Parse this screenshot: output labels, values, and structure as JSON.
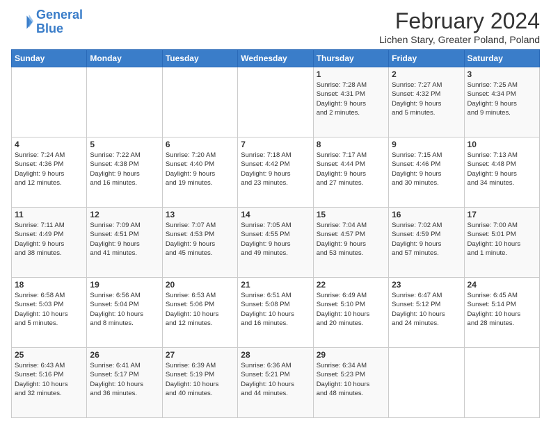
{
  "header": {
    "logo_line1": "General",
    "logo_line2": "Blue",
    "main_title": "February 2024",
    "subtitle": "Lichen Stary, Greater Poland, Poland"
  },
  "calendar": {
    "headers": [
      "Sunday",
      "Monday",
      "Tuesday",
      "Wednesday",
      "Thursday",
      "Friday",
      "Saturday"
    ],
    "weeks": [
      [
        {
          "day": "",
          "info": ""
        },
        {
          "day": "",
          "info": ""
        },
        {
          "day": "",
          "info": ""
        },
        {
          "day": "",
          "info": ""
        },
        {
          "day": "1",
          "info": "Sunrise: 7:28 AM\nSunset: 4:31 PM\nDaylight: 9 hours\nand 2 minutes."
        },
        {
          "day": "2",
          "info": "Sunrise: 7:27 AM\nSunset: 4:32 PM\nDaylight: 9 hours\nand 5 minutes."
        },
        {
          "day": "3",
          "info": "Sunrise: 7:25 AM\nSunset: 4:34 PM\nDaylight: 9 hours\nand 9 minutes."
        }
      ],
      [
        {
          "day": "4",
          "info": "Sunrise: 7:24 AM\nSunset: 4:36 PM\nDaylight: 9 hours\nand 12 minutes."
        },
        {
          "day": "5",
          "info": "Sunrise: 7:22 AM\nSunset: 4:38 PM\nDaylight: 9 hours\nand 16 minutes."
        },
        {
          "day": "6",
          "info": "Sunrise: 7:20 AM\nSunset: 4:40 PM\nDaylight: 9 hours\nand 19 minutes."
        },
        {
          "day": "7",
          "info": "Sunrise: 7:18 AM\nSunset: 4:42 PM\nDaylight: 9 hours\nand 23 minutes."
        },
        {
          "day": "8",
          "info": "Sunrise: 7:17 AM\nSunset: 4:44 PM\nDaylight: 9 hours\nand 27 minutes."
        },
        {
          "day": "9",
          "info": "Sunrise: 7:15 AM\nSunset: 4:46 PM\nDaylight: 9 hours\nand 30 minutes."
        },
        {
          "day": "10",
          "info": "Sunrise: 7:13 AM\nSunset: 4:48 PM\nDaylight: 9 hours\nand 34 minutes."
        }
      ],
      [
        {
          "day": "11",
          "info": "Sunrise: 7:11 AM\nSunset: 4:49 PM\nDaylight: 9 hours\nand 38 minutes."
        },
        {
          "day": "12",
          "info": "Sunrise: 7:09 AM\nSunset: 4:51 PM\nDaylight: 9 hours\nand 41 minutes."
        },
        {
          "day": "13",
          "info": "Sunrise: 7:07 AM\nSunset: 4:53 PM\nDaylight: 9 hours\nand 45 minutes."
        },
        {
          "day": "14",
          "info": "Sunrise: 7:05 AM\nSunset: 4:55 PM\nDaylight: 9 hours\nand 49 minutes."
        },
        {
          "day": "15",
          "info": "Sunrise: 7:04 AM\nSunset: 4:57 PM\nDaylight: 9 hours\nand 53 minutes."
        },
        {
          "day": "16",
          "info": "Sunrise: 7:02 AM\nSunset: 4:59 PM\nDaylight: 9 hours\nand 57 minutes."
        },
        {
          "day": "17",
          "info": "Sunrise: 7:00 AM\nSunset: 5:01 PM\nDaylight: 10 hours\nand 1 minute."
        }
      ],
      [
        {
          "day": "18",
          "info": "Sunrise: 6:58 AM\nSunset: 5:03 PM\nDaylight: 10 hours\nand 5 minutes."
        },
        {
          "day": "19",
          "info": "Sunrise: 6:56 AM\nSunset: 5:04 PM\nDaylight: 10 hours\nand 8 minutes."
        },
        {
          "day": "20",
          "info": "Sunrise: 6:53 AM\nSunset: 5:06 PM\nDaylight: 10 hours\nand 12 minutes."
        },
        {
          "day": "21",
          "info": "Sunrise: 6:51 AM\nSunset: 5:08 PM\nDaylight: 10 hours\nand 16 minutes."
        },
        {
          "day": "22",
          "info": "Sunrise: 6:49 AM\nSunset: 5:10 PM\nDaylight: 10 hours\nand 20 minutes."
        },
        {
          "day": "23",
          "info": "Sunrise: 6:47 AM\nSunset: 5:12 PM\nDaylight: 10 hours\nand 24 minutes."
        },
        {
          "day": "24",
          "info": "Sunrise: 6:45 AM\nSunset: 5:14 PM\nDaylight: 10 hours\nand 28 minutes."
        }
      ],
      [
        {
          "day": "25",
          "info": "Sunrise: 6:43 AM\nSunset: 5:16 PM\nDaylight: 10 hours\nand 32 minutes."
        },
        {
          "day": "26",
          "info": "Sunrise: 6:41 AM\nSunset: 5:17 PM\nDaylight: 10 hours\nand 36 minutes."
        },
        {
          "day": "27",
          "info": "Sunrise: 6:39 AM\nSunset: 5:19 PM\nDaylight: 10 hours\nand 40 minutes."
        },
        {
          "day": "28",
          "info": "Sunrise: 6:36 AM\nSunset: 5:21 PM\nDaylight: 10 hours\nand 44 minutes."
        },
        {
          "day": "29",
          "info": "Sunrise: 6:34 AM\nSunset: 5:23 PM\nDaylight: 10 hours\nand 48 minutes."
        },
        {
          "day": "",
          "info": ""
        },
        {
          "day": "",
          "info": ""
        }
      ]
    ]
  }
}
